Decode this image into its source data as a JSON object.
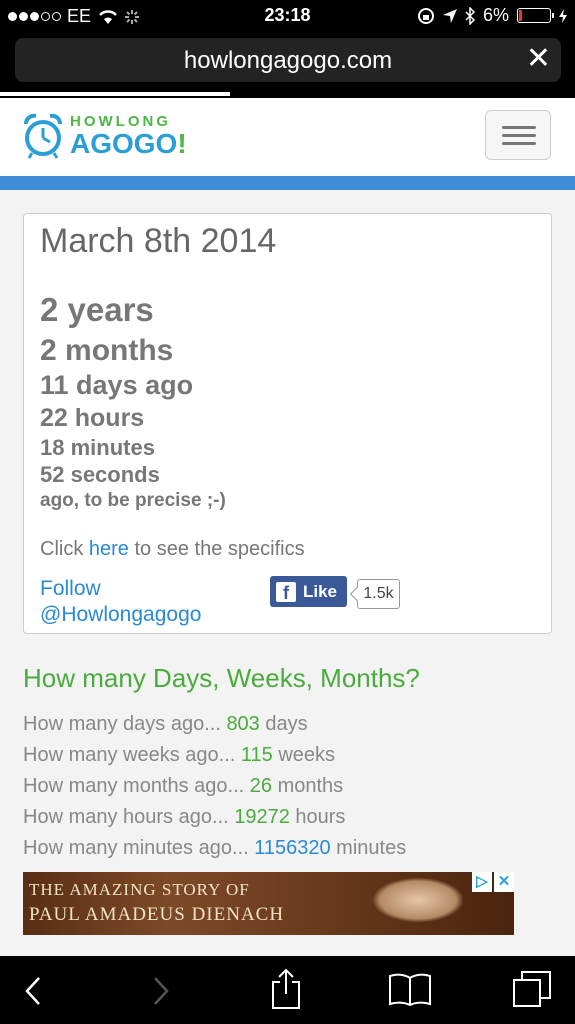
{
  "status_bar": {
    "carrier": "EE",
    "time": "23:18",
    "battery": "6%"
  },
  "browser": {
    "url": "howlongagogo.com",
    "load_progress": 0.4
  },
  "header": {
    "logo_line1": "HOWLONG",
    "logo_line2": "AGOGO",
    "logo_bang": "!"
  },
  "card": {
    "date": "March 8th 2014",
    "elapsed": [
      {
        "text": "2 years",
        "size": 33
      },
      {
        "text": "2 months",
        "size": 30
      },
      {
        "text": "11 days ago",
        "size": 27
      },
      {
        "text": "22 hours",
        "size": 25
      },
      {
        "text": "18 minutes",
        "size": 22
      },
      {
        "text": "52 seconds",
        "size": 22
      },
      {
        "text": "ago, to be precise ;-)",
        "size": 19
      }
    ],
    "click_prefix": "Click ",
    "click_link": "here",
    "click_suffix": " to see the specifics",
    "follow_line1": "Follow",
    "follow_line2": "@Howlongagogo",
    "like_label": "Like",
    "like_count": "1.5k"
  },
  "stats": {
    "heading": "How many Days, Weeks, Months?",
    "rows": [
      {
        "prefix": "How many days ago... ",
        "value": "803",
        "unit": " days"
      },
      {
        "prefix": "How many weeks ago... ",
        "value": "115",
        "unit": " weeks"
      },
      {
        "prefix": "How many months ago... ",
        "value": "26",
        "unit": " months"
      },
      {
        "prefix": "How many hours ago... ",
        "value": "19272",
        "unit": " hours"
      },
      {
        "prefix": "How many minutes ago... ",
        "value": "1156320",
        "unit": " minutes"
      }
    ]
  },
  "ad": {
    "line1": "THE AMAZING STORY OF",
    "line2": "PAUL AMADEUS DIENACH"
  }
}
